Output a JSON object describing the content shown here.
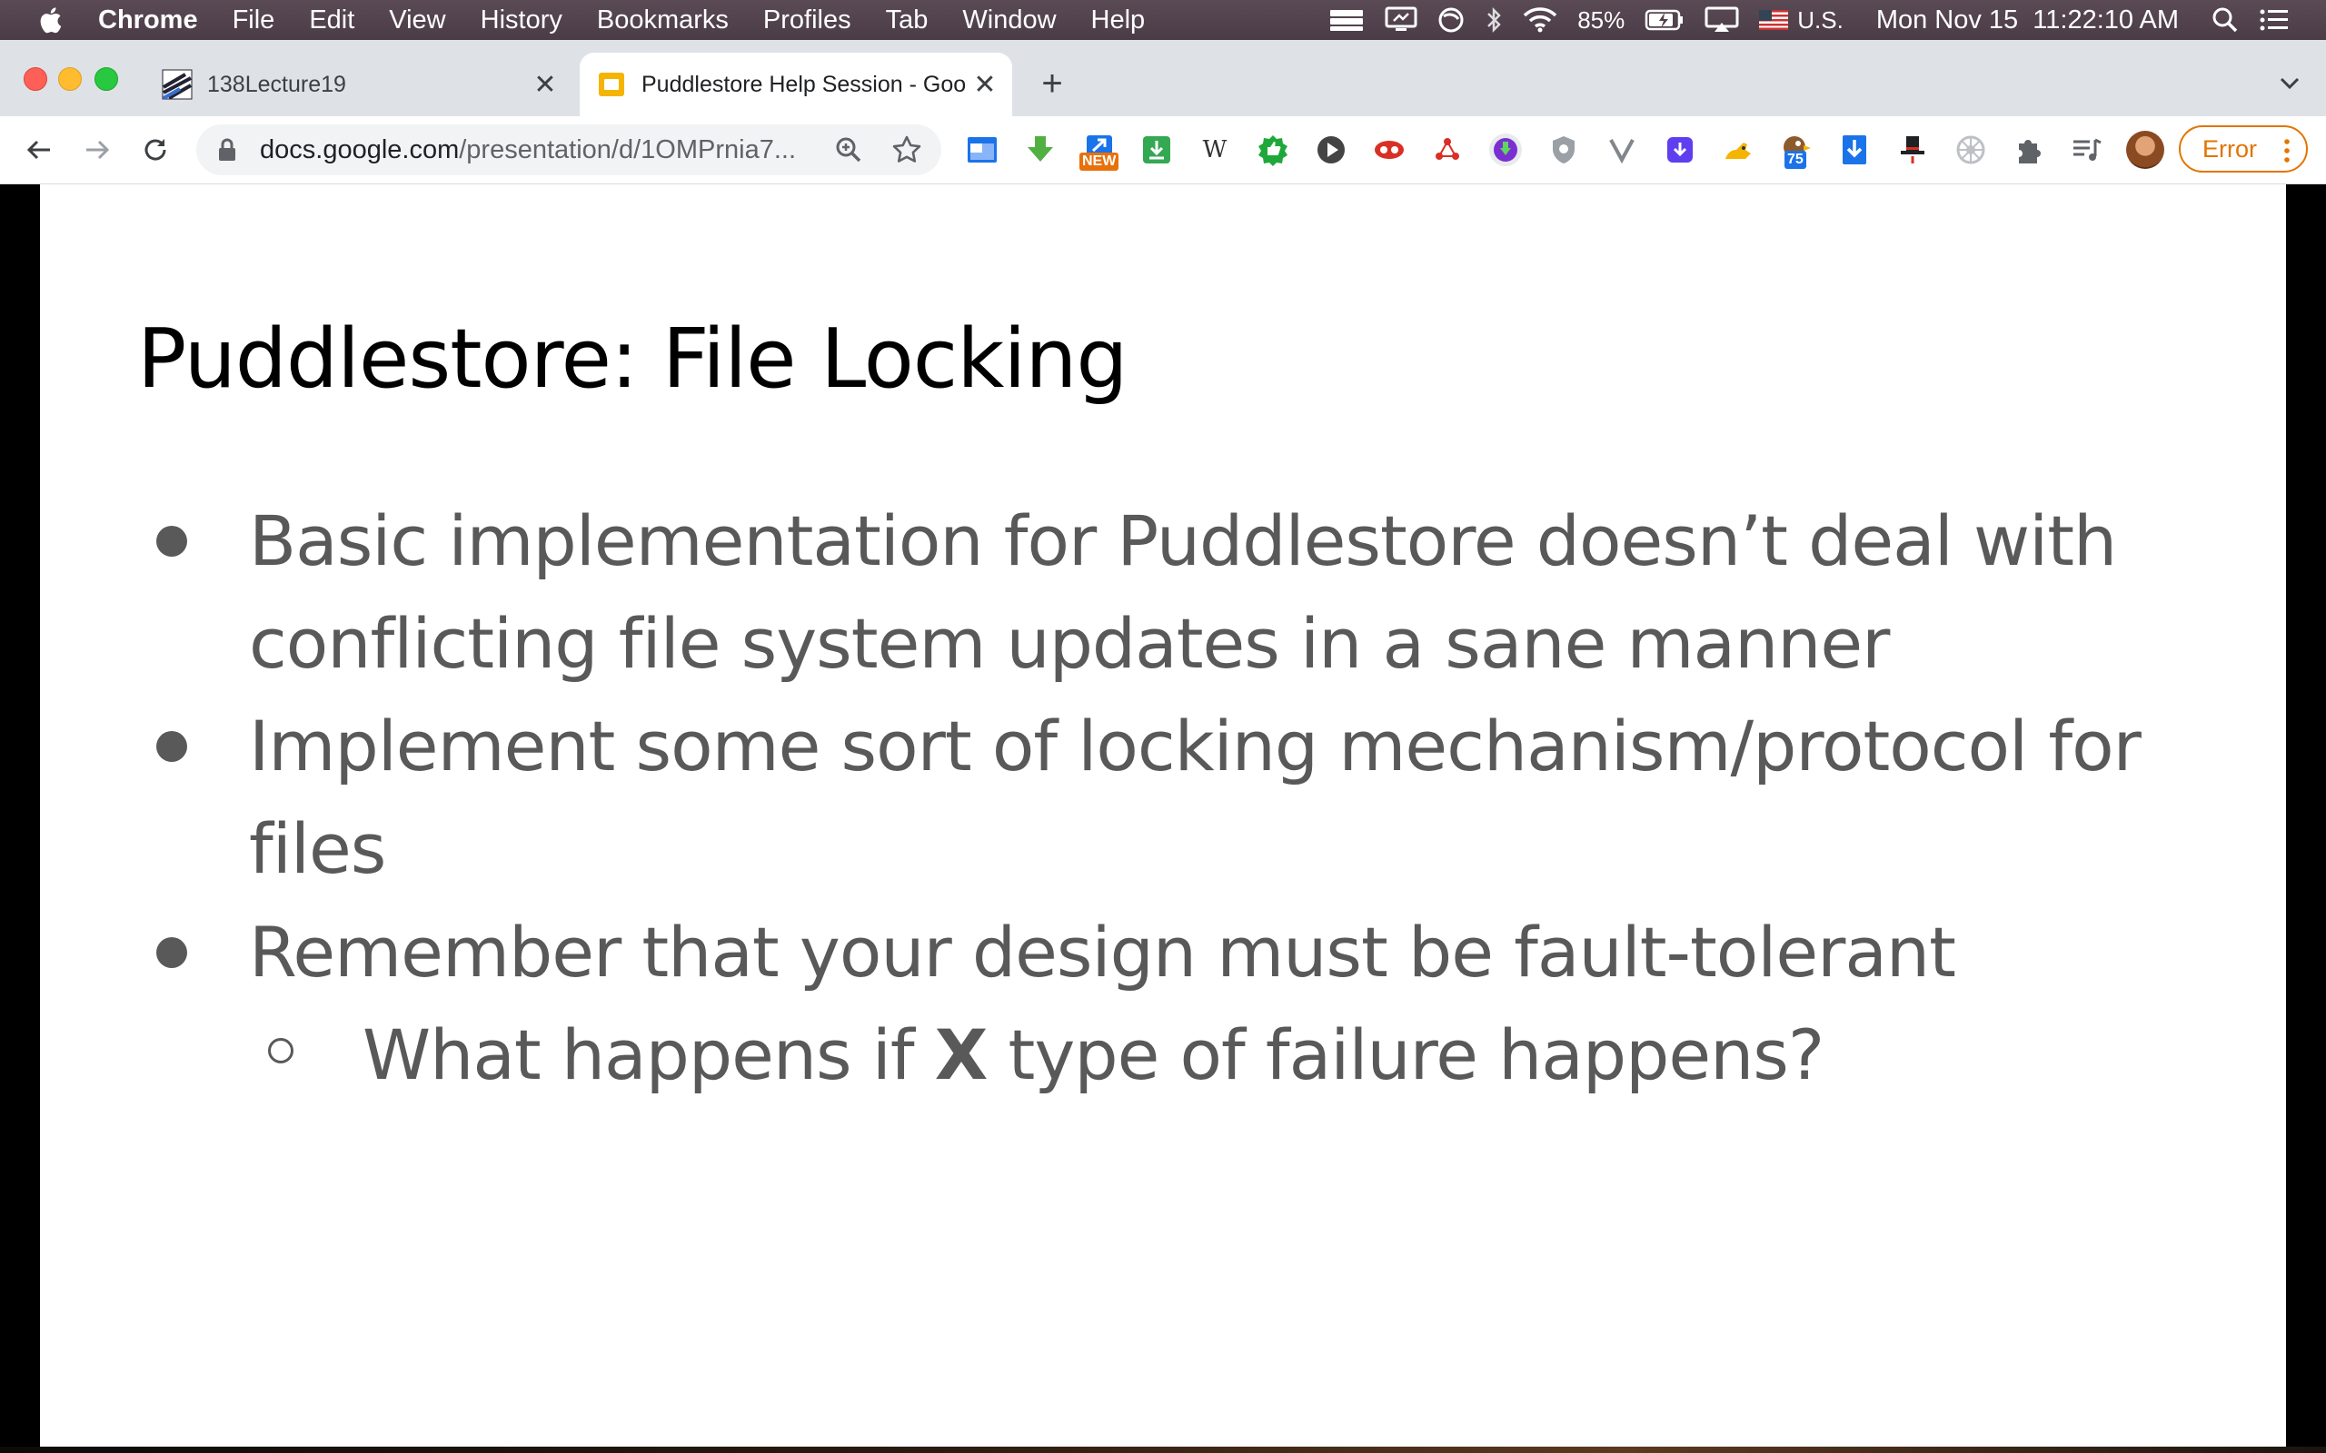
{
  "menubar": {
    "app_name": "Chrome",
    "items": [
      "File",
      "Edit",
      "View",
      "History",
      "Bookmarks",
      "Profiles",
      "Tab",
      "Window",
      "Help"
    ],
    "battery": "85%",
    "input_source": "U.S.",
    "clock": "Mon Nov 15  11:22:10 AM"
  },
  "tabs": [
    {
      "title": "138Lecture19",
      "active": false
    },
    {
      "title": "Puddlestore Help Session - Goo",
      "active": true
    }
  ],
  "toolbar": {
    "url_host": "docs.google.com",
    "url_path": "/presentation/d/1OMPrnia7...",
    "ext_badge_new": "NEW",
    "ext_badge_count": "75",
    "ext_wiki_letter": "W",
    "error_label": "Error"
  },
  "slide": {
    "title": "Puddlestore: File Locking",
    "bullets": [
      {
        "line1": "Basic implementation for Puddlestore doesn’t deal with",
        "line2": "conflicting file system updates in a sane manner"
      },
      {
        "line1": "Implement some sort of locking mechanism/protocol for",
        "line2": "files"
      },
      {
        "line1": "Remember that your design must be fault-tolerant"
      }
    ],
    "sub_bullet": {
      "before": "What happens if ",
      "bold": "X",
      "after": " type of failure happens?"
    }
  },
  "colors": {
    "menubar": "#4f414c",
    "tabstrip": "#dee1e6",
    "slide_text": "#595959",
    "error_accent": "#e37400"
  }
}
